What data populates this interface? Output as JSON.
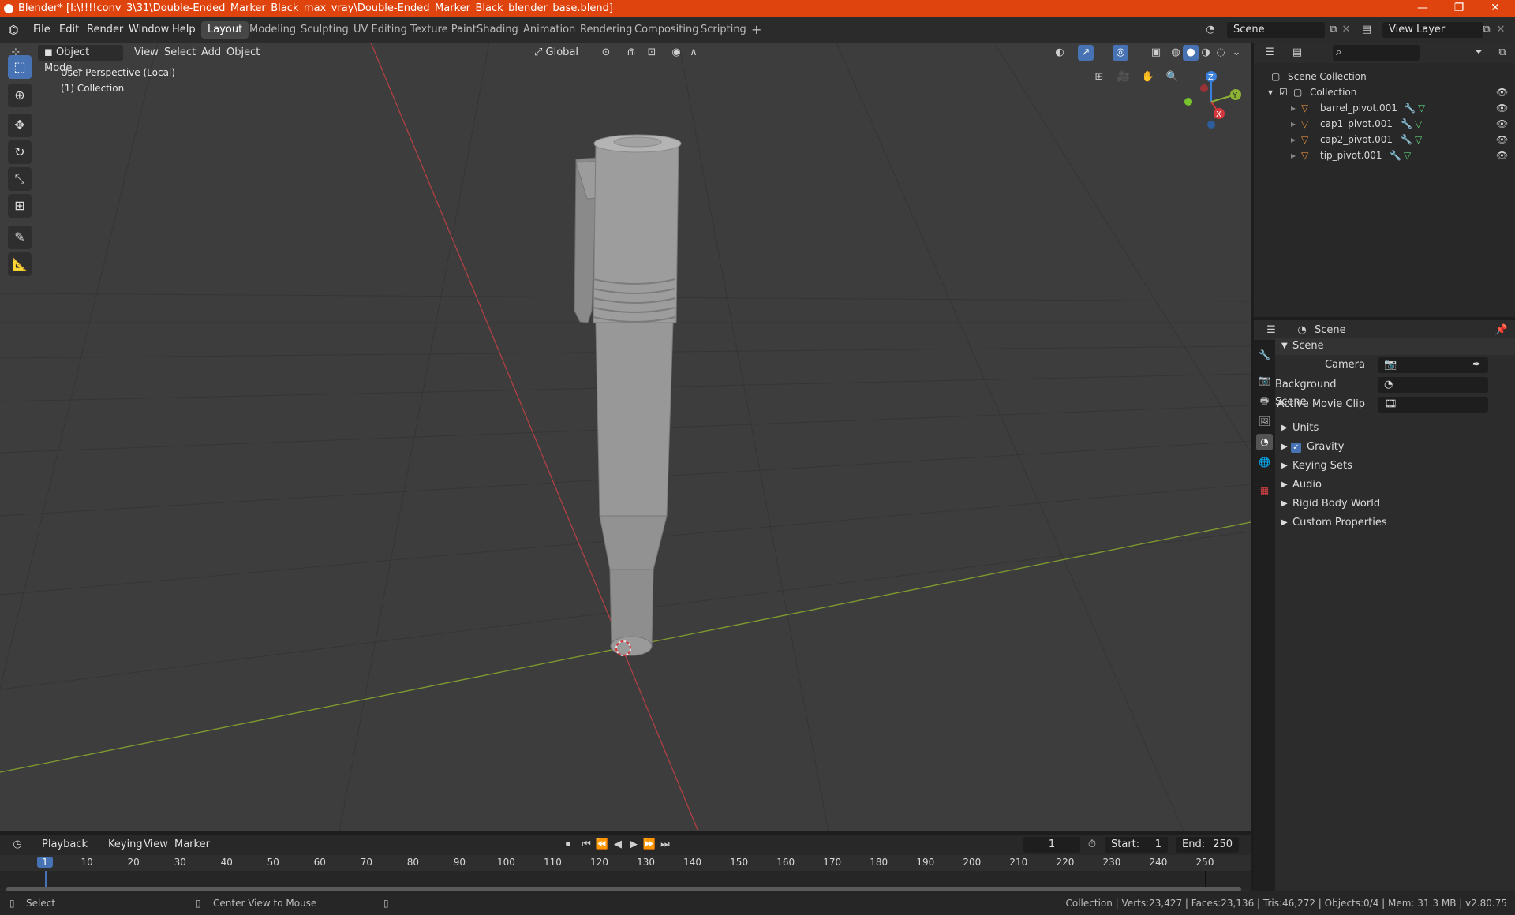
{
  "window": {
    "title": "Blender* [I:\\!!!!conv_3\\31\\Double-Ended_Marker_Black_max_vray\\Double-Ended_Marker_Black_blender_base.blend]",
    "controls": [
      "—",
      "❐",
      "✕"
    ]
  },
  "menu": {
    "items": [
      "File",
      "Edit",
      "Render",
      "Window",
      "Help"
    ],
    "workspaces": [
      "Layout",
      "Modeling",
      "Sculpting",
      "UV Editing",
      "Texture Paint",
      "Shading",
      "Animation",
      "Rendering",
      "Compositing",
      "Scripting"
    ],
    "active_workspace": "Layout",
    "add_workspace": "+",
    "scene": "Scene",
    "view_layer": "View Layer"
  },
  "viewport": {
    "mode": "Object Mode",
    "menus": [
      "View",
      "Select",
      "Add",
      "Object"
    ],
    "orientation": "Global",
    "overlay_line1": "User Perspective (Local)",
    "overlay_line2": "(1) Collection",
    "gizmo": {
      "x": "X",
      "y": "Y",
      "z": "Z"
    }
  },
  "outliner": {
    "root": "Scene Collection",
    "collection": "Collection",
    "objects": [
      "barrel_pivot.001",
      "cap1_pivot.001",
      "cap2_pivot.001",
      "tip_pivot.001"
    ]
  },
  "properties": {
    "header": "Scene",
    "panel": "Scene",
    "fields": [
      {
        "label": "Camera",
        "value": ""
      },
      {
        "label": "Background Scene",
        "value": ""
      },
      {
        "label": "Active Movie Clip",
        "value": ""
      }
    ],
    "sections": [
      "Units",
      "Gravity",
      "Keying Sets",
      "Audio",
      "Rigid Body World",
      "Custom Properties"
    ],
    "gravity_checked": true
  },
  "timeline": {
    "menus": [
      "Playback",
      "Keying",
      "View",
      "Marker"
    ],
    "current_frame": "1",
    "start_label": "Start:",
    "start": "1",
    "end_label": "End:",
    "end": "250",
    "ruler": [
      "1",
      "10",
      "20",
      "30",
      "40",
      "50",
      "60",
      "70",
      "80",
      "90",
      "100",
      "110",
      "120",
      "130",
      "140",
      "150",
      "160",
      "170",
      "180",
      "190",
      "200",
      "210",
      "220",
      "230",
      "240",
      "250"
    ]
  },
  "status": {
    "left": "Select",
    "middle": "Center View to Mouse",
    "right": "Collection | Verts:23,427 | Faces:23,136 | Tris:46,272 | Objects:0/4 | Mem: 31.3 MB | v2.80.75"
  },
  "colors": {
    "titlebar": "#e0440e",
    "accent": "#4772b3",
    "x_axis": "#d4383d",
    "y_axis": "#8db336",
    "z_axis": "#3b80dc",
    "object_icon": "#e08b3a"
  }
}
